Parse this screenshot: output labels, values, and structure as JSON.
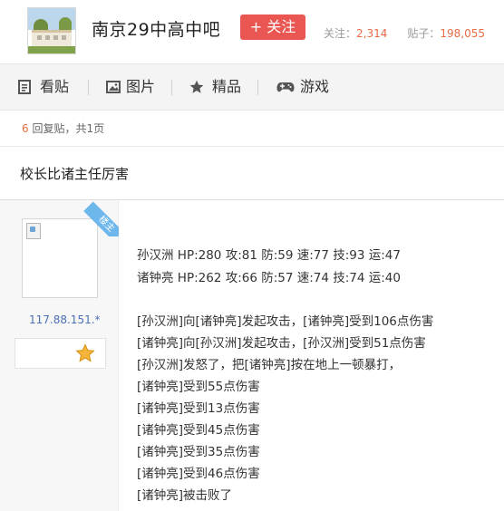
{
  "header": {
    "forum_name": "南京29中高中吧",
    "follow_label": "+ 关注",
    "followers_label": "关注：",
    "followers_count": "2,314",
    "posts_label": "贴子：",
    "posts_count": "198,055"
  },
  "nav": {
    "items": [
      {
        "label": "看贴",
        "icon": "document-icon"
      },
      {
        "label": "图片",
        "icon": "picture-icon"
      },
      {
        "label": "精品",
        "icon": "star-icon"
      },
      {
        "label": "游戏",
        "icon": "gamepad-icon"
      }
    ]
  },
  "pager": {
    "reply_count": "6",
    "reply_text": " 回复贴，共1页"
  },
  "thread": {
    "title": "校长比诸主任厉害"
  },
  "author": {
    "badge": "楼主",
    "ip": "117.88.151.*"
  },
  "post": {
    "stats": [
      "孙汉洲  HP:280 攻:81 防:59 速:77 技:93 运:47",
      "诸钟亮  HP:262 攻:66 防:57 速:74 技:74 运:40"
    ],
    "battle": [
      "[孙汉洲]向[诸钟亮]发起攻击，[诸钟亮]受到106点伤害",
      "[诸钟亮]向[孙汉洲]发起攻击，[孙汉洲]受到51点伤害",
      "[孙汉洲]发怒了，把[诸钟亮]按在地上一顿暴打，",
      "[诸钟亮]受到55点伤害",
      "[诸钟亮]受到13点伤害",
      "[诸钟亮]受到45点伤害",
      "[诸钟亮]受到35点伤害",
      "[诸钟亮]受到46点伤害",
      "[诸钟亮]被击败了"
    ]
  },
  "colors": {
    "accent": "#ea5752",
    "number": "#e96c45",
    "ip_link": "#4a6fb5",
    "ribbon": "#6db7ec",
    "star": "#f5b53a"
  }
}
